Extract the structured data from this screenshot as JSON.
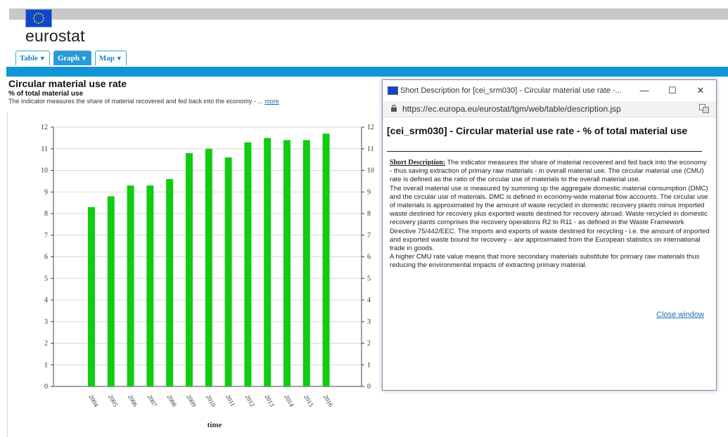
{
  "header": {
    "logo_text": "eurostat",
    "tabs": [
      {
        "label": "Table",
        "active": false
      },
      {
        "label": "Graph",
        "active": true
      },
      {
        "label": "Map",
        "active": false
      }
    ],
    "accent_color": "#1096d6"
  },
  "dataset": {
    "title": "Circular material use rate",
    "subtitle": "% of total material use",
    "description": "The indicator measures the share of material recovered and fed back into the economy - ...",
    "more_link": "more"
  },
  "chart_data": {
    "type": "bar",
    "categories": [
      "2004",
      "2005",
      "2006",
      "2007",
      "2008",
      "2009",
      "2010",
      "2011",
      "2012",
      "2013",
      "2014",
      "2015",
      "2016"
    ],
    "values": [
      8.3,
      8.8,
      9.3,
      9.3,
      9.6,
      10.8,
      11.0,
      10.6,
      11.3,
      11.5,
      11.4,
      11.4,
      11.7
    ],
    "xlabel": "time",
    "ylabel": "",
    "ylim": [
      0,
      12
    ],
    "yticks": [
      0,
      1,
      2,
      3,
      4,
      5,
      6,
      7,
      8,
      9,
      10,
      11,
      12
    ],
    "bar_color": "#11cc11",
    "grid": true,
    "right_axis": true
  },
  "popup": {
    "window_title": "Short Description for [cei_srm030] - Circular material use rate -...",
    "minimize": "—",
    "maximize": "☐",
    "close": "✕",
    "url": "https://ec.europa.eu/eurostat/tgm/web/table/description.jsp",
    "heading": "[cei_srm030] - Circular material use rate - % of total material use",
    "lead": "Short Description:",
    "paragraph1": " The indicator measures the share of material recovered and fed back into the economy - thus saving extraction of primary raw materials - in overall material use. The circular material use (CMU) rate is defined as the ratio of the circular use of materials to the overall material use.",
    "paragraph2": "The overall material use is measured by summing up the aggregate domestic material consumption (DMC) and the circular use of materials. DMC is defined in economy-wide material flow accounts. The circular use of materials is approximated by the amount of waste recycled in domestic recovery plants minus imported waste destined for recovery plus exported waste destined for recovery abroad. Waste recycled in domestic recovery plants comprises the recovery operations R2 to R11 - as defined in the Waste Framework Directive 75/442/EEC. The imports and exports of waste destined for recycling - i.e. the amount of imported and exported waste bound for recovery – are approximated from the European statistics on international trade in goods.",
    "paragraph3": "A higher CMU rate value means that more secondary materials substitute for primary raw materials thus reducing the environmental impacts of extracting primary material.",
    "close_link": "Close window"
  }
}
